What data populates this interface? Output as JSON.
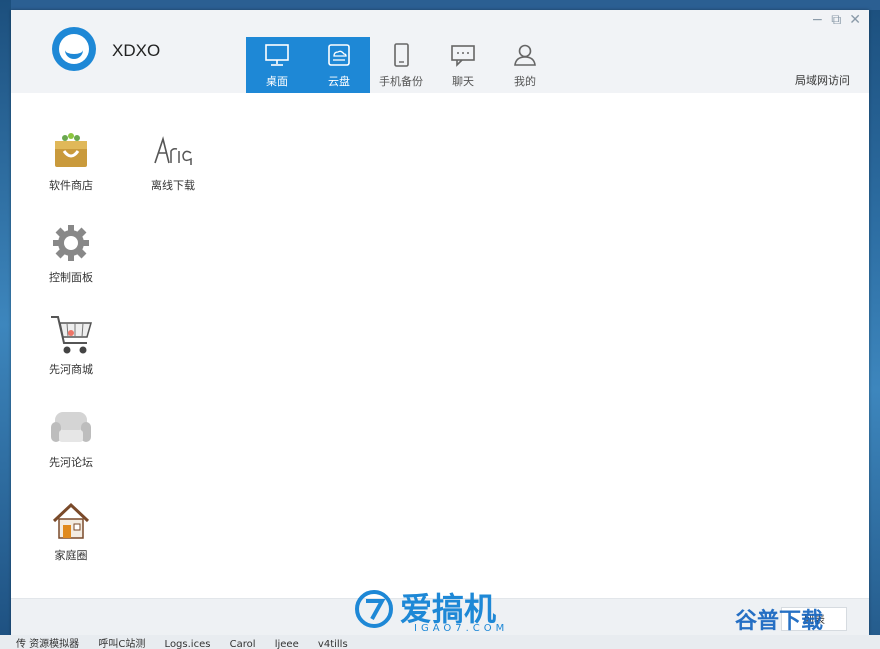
{
  "window": {
    "brand": "XDXO",
    "controls": {
      "minimize": "−",
      "restore": "⧉",
      "close": "✕"
    }
  },
  "tabs": [
    {
      "label": "桌面",
      "icon": "monitor-icon",
      "active": true
    },
    {
      "label": "云盘",
      "icon": "cloud-drive-icon",
      "active": true
    },
    {
      "label": "手机备份",
      "icon": "phone-icon",
      "active": false
    },
    {
      "label": "聊天",
      "icon": "chat-icon",
      "active": false
    },
    {
      "label": "我的",
      "icon": "user-icon",
      "active": false
    }
  ],
  "header": {
    "lan_access": "局域网访问"
  },
  "apps": [
    {
      "label": "软件商店",
      "icon": "store-bag-icon"
    },
    {
      "label": "离线下载",
      "icon": "aria-logo-icon"
    },
    {
      "label": "控制面板",
      "icon": "gear-icon"
    },
    {
      "label": "先河商城",
      "icon": "shopping-cart-icon"
    },
    {
      "label": "先河论坛",
      "icon": "sofa-icon"
    },
    {
      "label": "家庭圈",
      "icon": "house-icon"
    }
  ],
  "footer": {
    "list_button": "列表",
    "watermark_main": "爱搞机",
    "watermark_sub": "IGAO7.COM",
    "watermark_right": "谷普下载"
  },
  "taskbar": {
    "items": [
      "传  资源模拟器",
      "呼叫C站测",
      "Logs.ices",
      "Carol",
      "ljeee",
      "v4tills"
    ]
  },
  "colors": {
    "accent": "#1e88d6",
    "header_bg": "#f1f3f6"
  }
}
